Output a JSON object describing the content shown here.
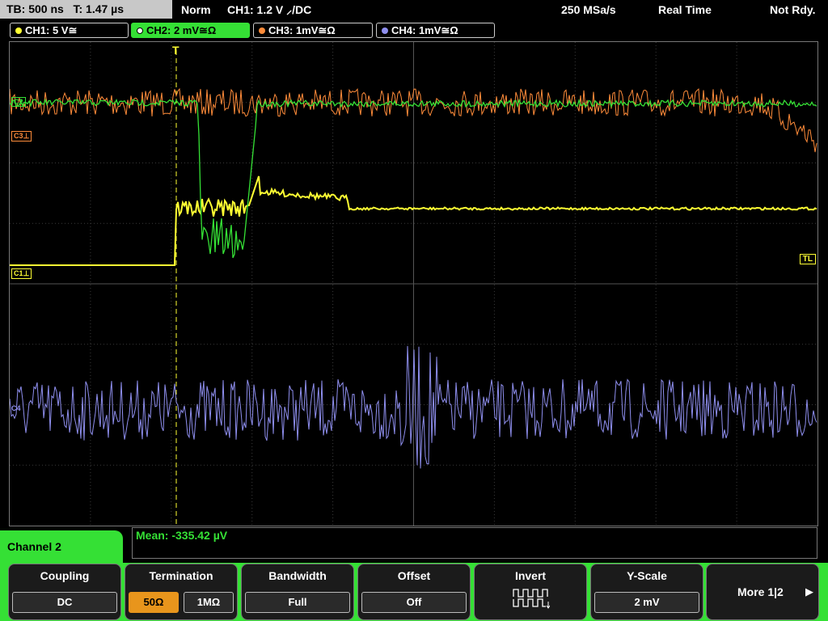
{
  "status_bar": {
    "timebase": "TB: 500 ns",
    "trigger_time": "T: 1.47 µs",
    "mode": "Norm",
    "trigger": "CH1: 1.2 V ⸝/DC",
    "sample_rate": "250 MSa/s",
    "acq_mode": "Real Time",
    "state": "Not Rdy."
  },
  "channel_tabs": [
    {
      "label": "CH1: 5 V≅",
      "color": "#ffff33"
    },
    {
      "label": "CH2: 2 mV≅Ω",
      "color": "#35e035"
    },
    {
      "label": "CH3: 1mV≅Ω",
      "color": "#ff8c3a"
    },
    {
      "label": "CH4: 1mV≅Ω",
      "color": "#8f8fef"
    }
  ],
  "screen": {
    "trigger_marker": "T",
    "trigger_level_marker": "TL",
    "ch1_marker": "C1",
    "ch2_marker": "C2",
    "ch3_marker": "C3",
    "ch4_marker": "C4"
  },
  "measurement": {
    "mean": "Mean: -335.42 µV"
  },
  "menu": {
    "title": "Channel 2",
    "coupling": {
      "title": "Coupling",
      "value": "DC"
    },
    "termination": {
      "title": "Termination",
      "opt1": "50Ω",
      "opt2": "1MΩ",
      "selected": "50Ω"
    },
    "bandwidth": {
      "title": "Bandwidth",
      "value": "Full"
    },
    "offset": {
      "title": "Offset",
      "value": "Off"
    },
    "invert": {
      "title": "Invert"
    },
    "yscale": {
      "title": "Y-Scale",
      "value": "2 mV"
    },
    "more": {
      "label": "More 1|2",
      "arrow": "▶"
    }
  },
  "colors": {
    "ch1": "#ffff33",
    "ch2": "#35e035",
    "ch3": "#ff8c3a",
    "ch4": "#8f8fef",
    "softkey_accent": "#35e035"
  }
}
